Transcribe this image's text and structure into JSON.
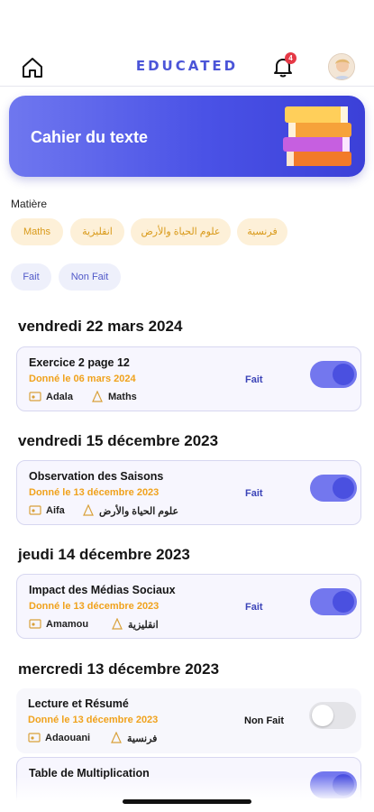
{
  "header": {
    "logo_text": "EDUCATED",
    "notification_count": "4",
    "home_icon": "home-icon",
    "bell_icon": "bell-icon"
  },
  "banner": {
    "title": "Cahier du texte",
    "illustration": "books-stack-illustration"
  },
  "filters": {
    "subject_label": "Matière",
    "subjects": [
      "Maths",
      "انقليزية",
      "علوم الحياة والأرض",
      "فرنسية"
    ],
    "statuses": [
      "Fait",
      "Non Fait"
    ]
  },
  "days": [
    {
      "date": "vendredi 22 mars 2024",
      "items": [
        {
          "title": "Exercice 2 page 12",
          "given": "Donné le 06 mars 2024",
          "teacher": "Adala",
          "subject": "Maths",
          "status": "Fait",
          "done": true
        }
      ]
    },
    {
      "date": "vendredi 15 décembre 2023",
      "items": [
        {
          "title": "Observation des Saisons",
          "given": "Donné le 13 décembre 2023",
          "teacher": "Aifa",
          "subject": "علوم الحياة والأرض",
          "status": "Fait",
          "done": true
        }
      ]
    },
    {
      "date": "jeudi 14 décembre 2023",
      "items": [
        {
          "title": "Impact des Médias Sociaux",
          "given": "Donné le 13 décembre 2023",
          "teacher": "Amamou",
          "subject": "انقليزية",
          "status": "Fait",
          "done": true
        }
      ]
    },
    {
      "date": "mercredi 13 décembre 2023",
      "items": [
        {
          "title": "Lecture et Résumé",
          "given": "Donné le 13 décembre 2023",
          "teacher": "Adaouani",
          "subject": "فرنسية",
          "status": "Non Fait",
          "done": false
        },
        {
          "title": "Table de Multiplication",
          "done": true
        }
      ]
    }
  ],
  "colors": {
    "brand": "#4b55d8",
    "banner_gradient_start": "#6f77ef",
    "banner_gradient_end": "#3b40d8",
    "accent_orange": "#f0a21c",
    "toggle_on": "#7377ee",
    "toggle_off": "#e4e4e8"
  }
}
